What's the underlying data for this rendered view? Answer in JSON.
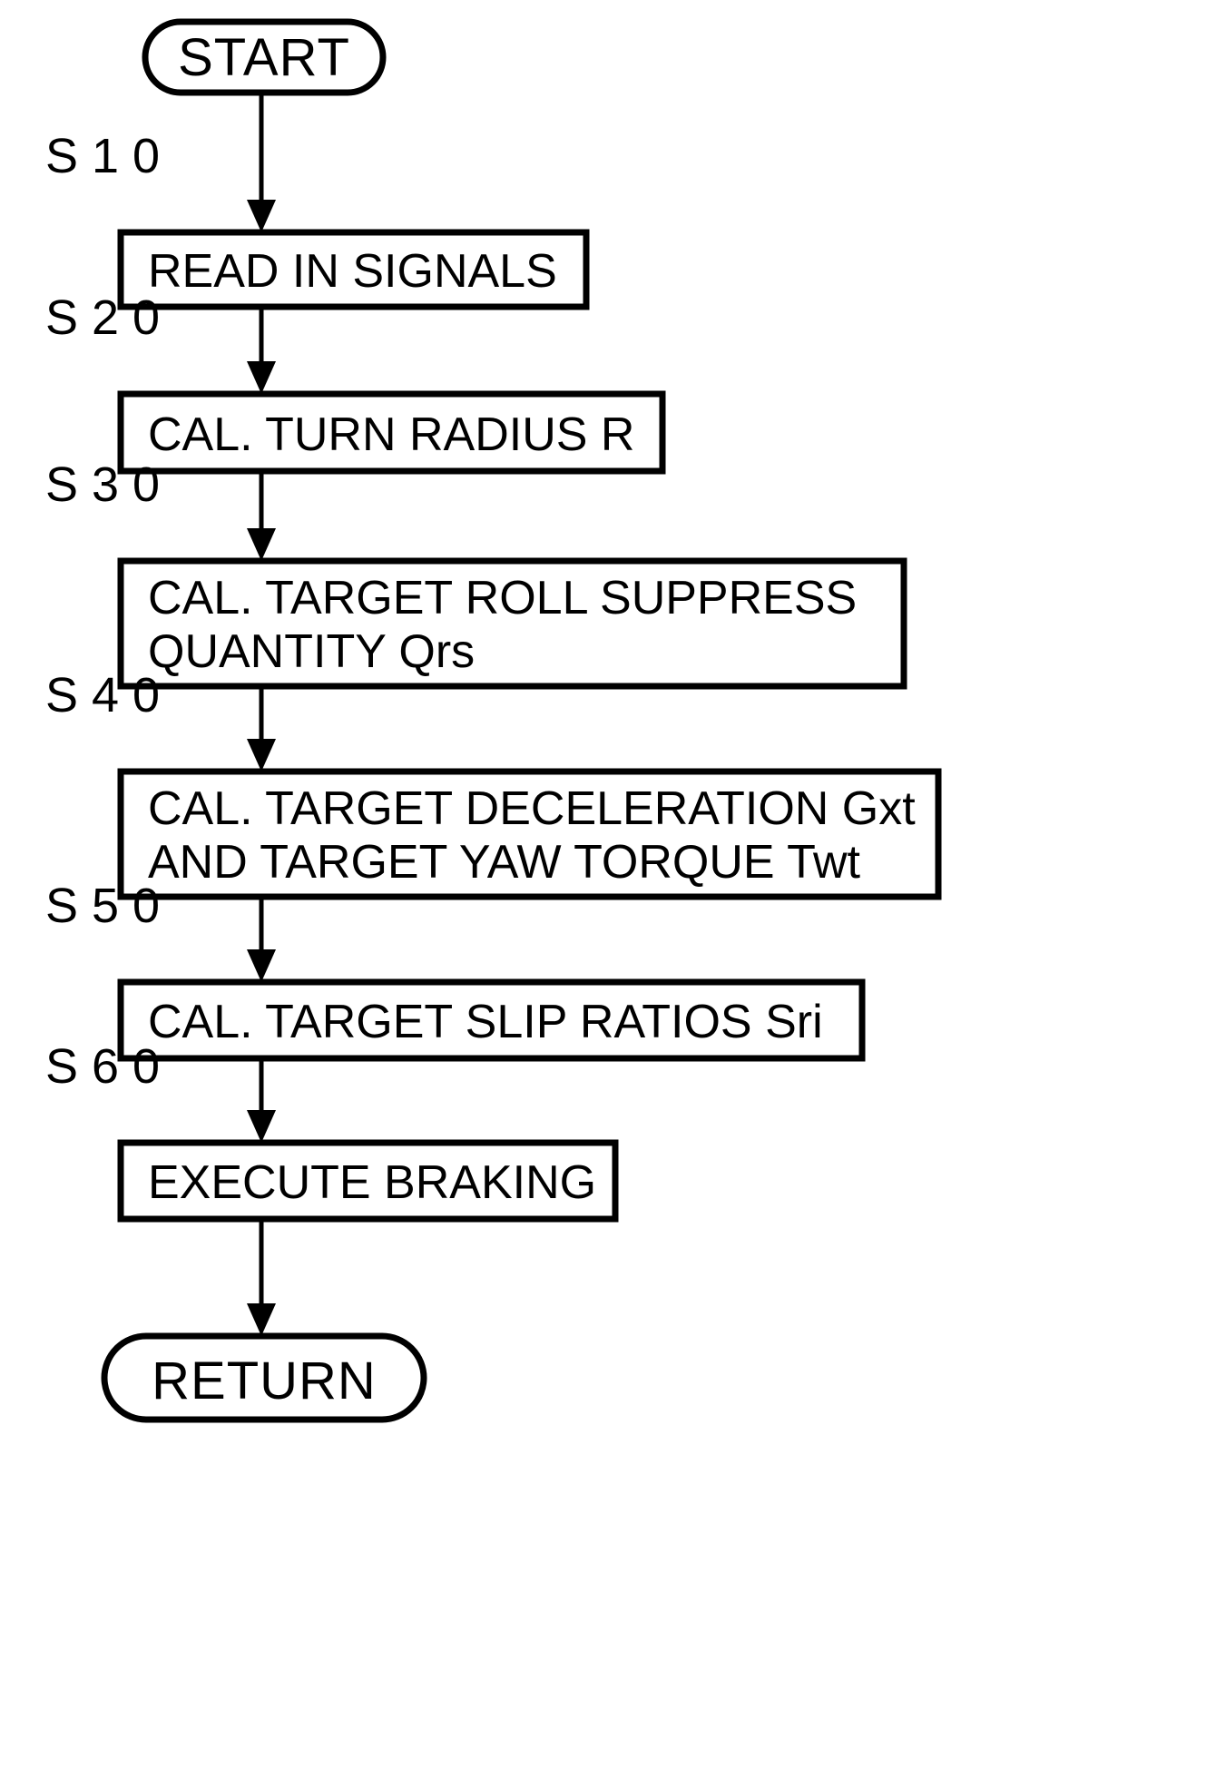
{
  "diagram": {
    "type": "flowchart",
    "orientation": "vertical",
    "title": "",
    "start_label": "START",
    "end_label": "RETURN",
    "step_labels": [
      "S 1 0",
      "S 2 0",
      "S 3 0",
      "S 4 0",
      "S 5 0",
      "S 6 0"
    ],
    "steps": [
      {
        "id": "S10",
        "step_label": "S 1 0",
        "lines": [
          "READ IN SIGNALS"
        ],
        "line1": "READ IN SIGNALS",
        "line2": ""
      },
      {
        "id": "S20",
        "step_label": "S 2 0",
        "lines": [
          "CAL. TURN RADIUS R"
        ],
        "line1": "CAL. TURN RADIUS R",
        "line2": ""
      },
      {
        "id": "S30",
        "step_label": "S 3 0",
        "lines": [
          "CAL. TARGET ROLL SUPPRESS",
          "QUANTITY Qrs"
        ],
        "line1": "CAL. TARGET ROLL SUPPRESS",
        "line2": "QUANTITY Qrs"
      },
      {
        "id": "S40",
        "step_label": "S 4 0",
        "lines": [
          "CAL. TARGET DECELERATION Gxt",
          "AND TARGET YAW TORQUE Twt"
        ],
        "line1": "CAL. TARGET DECELERATION Gxt",
        "line2": "AND TARGET YAW TORQUE Twt"
      },
      {
        "id": "S50",
        "step_label": "S 5 0",
        "lines": [
          "CAL. TARGET SLIP RATIOS Sri"
        ],
        "line1": "CAL. TARGET SLIP RATIOS Sri",
        "line2": ""
      },
      {
        "id": "S60",
        "step_label": "S 6 0",
        "lines": [
          "EXECUTE BRAKING"
        ],
        "line1": "EXECUTE BRAKING",
        "line2": ""
      }
    ],
    "colors": {
      "background": "#ffffff",
      "stroke": "#000000",
      "text": "#000000"
    }
  }
}
